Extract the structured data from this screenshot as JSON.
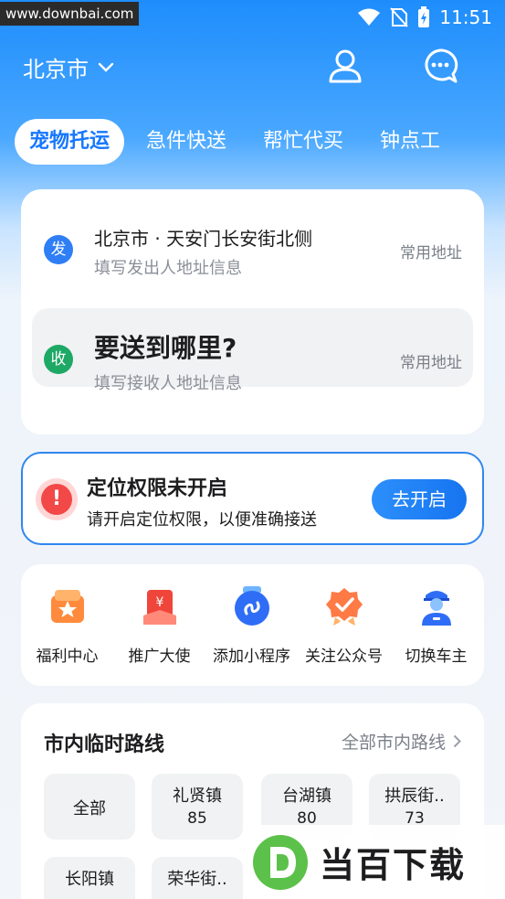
{
  "watermark_url": "www.downbai.com",
  "status": {
    "time": "11:51"
  },
  "header": {
    "city": "北京市"
  },
  "tabs": [
    {
      "label": "宠物托运",
      "active": true
    },
    {
      "label": "急件快送"
    },
    {
      "label": "帮忙代买"
    },
    {
      "label": "钟点工"
    }
  ],
  "address": {
    "send": {
      "badge": "发",
      "title": "北京市 · 天安门长安街北侧",
      "sub": "填写发出人地址信息",
      "link": "常用地址"
    },
    "recv": {
      "badge": "收",
      "title": "要送到哪里?",
      "sub": "填写接收人地址信息",
      "link": "常用地址"
    }
  },
  "permission": {
    "title": "定位权限未开启",
    "sub": "请开启定位权限，以便准确接送",
    "button": "去开启"
  },
  "services": [
    {
      "label": "福利中心",
      "icon": "gift-icon"
    },
    {
      "label": "推广大使",
      "icon": "red-envelope-icon"
    },
    {
      "label": "添加小程序",
      "icon": "mini-program-icon"
    },
    {
      "label": "关注公众号",
      "icon": "badge-check-icon"
    },
    {
      "label": "切换车主",
      "icon": "driver-icon"
    }
  ],
  "routes": {
    "title": "市内临时路线",
    "all_label": "全部市内路线",
    "items": [
      {
        "name": "全部",
        "count": ""
      },
      {
        "name": "礼贤镇",
        "count": "85"
      },
      {
        "name": "台湖镇",
        "count": "80"
      },
      {
        "name": "拱辰街..",
        "count": "73"
      },
      {
        "name": "长阳镇",
        "count": ""
      },
      {
        "name": "荣华街..",
        "count": ""
      }
    ]
  },
  "logo_watermark": "当百下载",
  "colors": {
    "primary": "#1677ff",
    "send_badge": "#2f7ef5",
    "recv_badge": "#1ea866",
    "alert": "#f24848"
  }
}
